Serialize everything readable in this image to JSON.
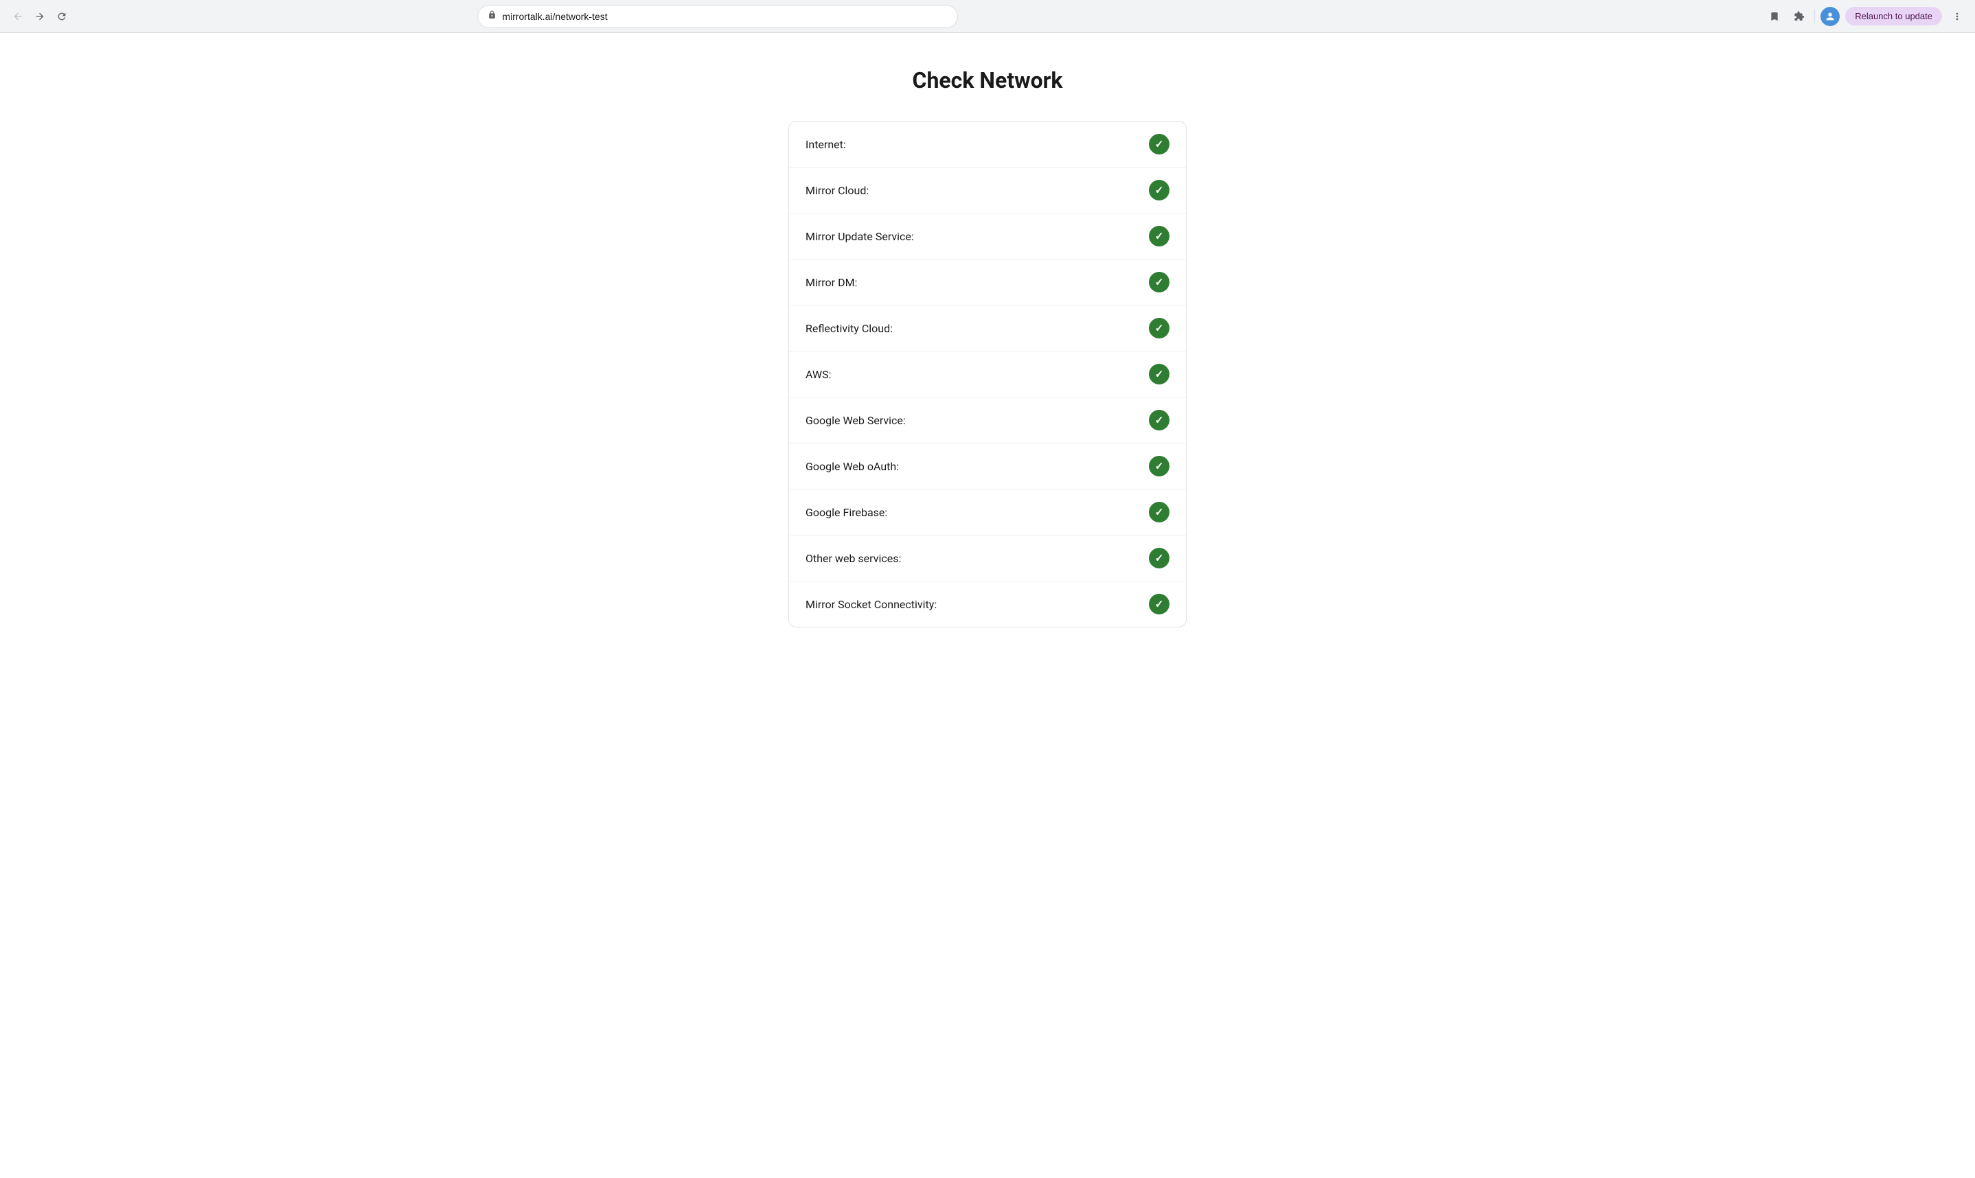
{
  "browser": {
    "url": "mirrortalk.ai/network-test",
    "relaunch_label": "Relaunch to update",
    "back_title": "Back",
    "forward_title": "Forward",
    "reload_title": "Reload"
  },
  "page": {
    "title": "Check Network",
    "network_items": [
      {
        "id": "internet",
        "label": "Internet:",
        "status": "ok"
      },
      {
        "id": "mirror-cloud",
        "label": "Mirror Cloud:",
        "status": "ok"
      },
      {
        "id": "mirror-update-service",
        "label": "Mirror Update Service:",
        "status": "ok"
      },
      {
        "id": "mirror-dm",
        "label": "Mirror DM:",
        "status": "ok"
      },
      {
        "id": "reflectivity-cloud",
        "label": "Reflectivity Cloud:",
        "status": "ok"
      },
      {
        "id": "aws",
        "label": "AWS:",
        "status": "ok"
      },
      {
        "id": "google-web-service",
        "label": "Google Web Service:",
        "status": "ok"
      },
      {
        "id": "google-web-oauth",
        "label": "Google Web oAuth:",
        "status": "ok"
      },
      {
        "id": "google-firebase",
        "label": "Google Firebase:",
        "status": "ok"
      },
      {
        "id": "other-web-services",
        "label": "Other web services:",
        "status": "ok"
      },
      {
        "id": "mirror-socket-connectivity",
        "label": "Mirror Socket Connectivity:",
        "status": "ok"
      }
    ]
  }
}
